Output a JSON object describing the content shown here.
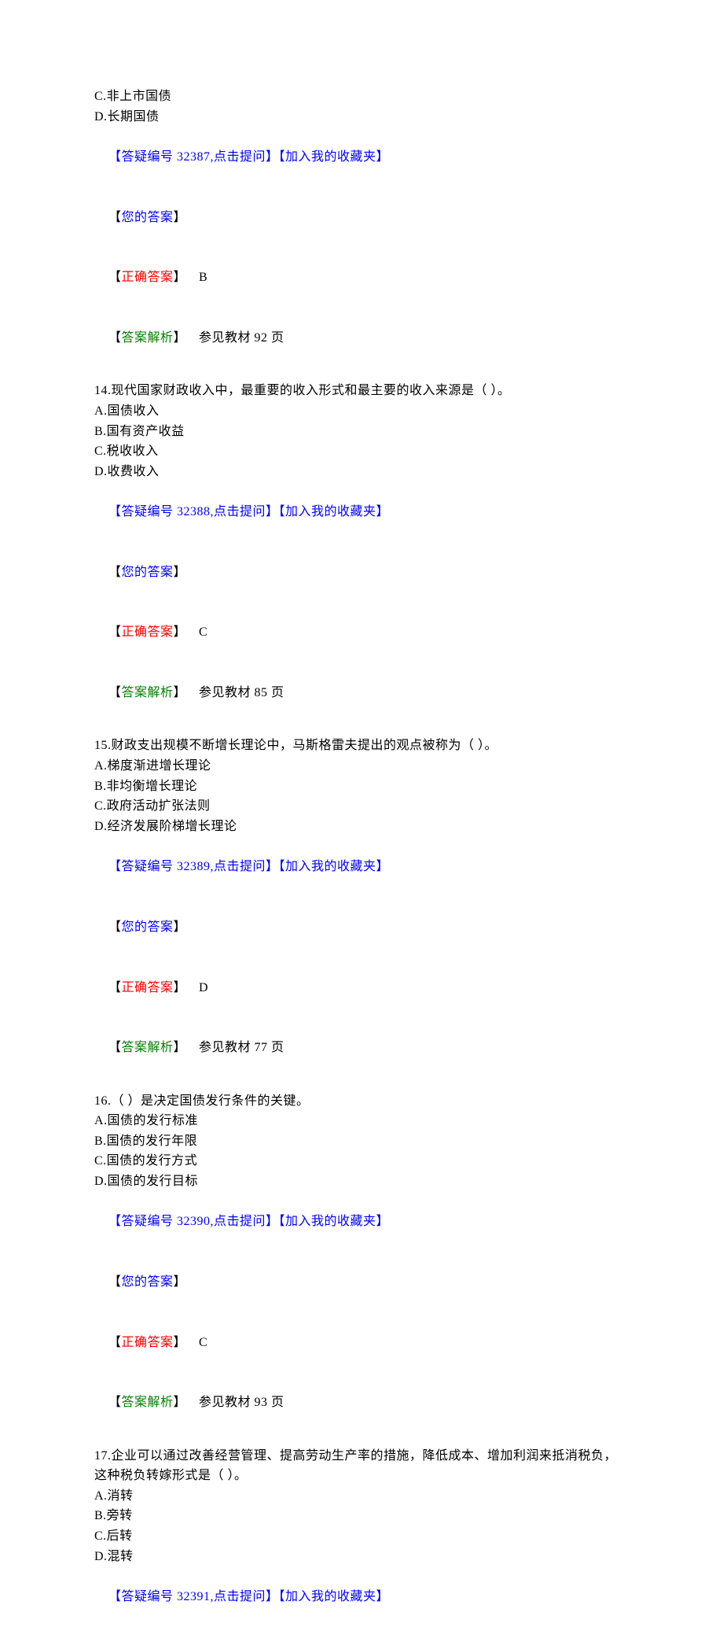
{
  "q13": {
    "optC": "C.非上市国债",
    "optD": "D.长期国债",
    "askPrefix": "【答疑编号 32387,点击提问】",
    "fav": "【加入我的收藏夹】",
    "yourLabelOpen": "【",
    "yourLabelText": "您的答案",
    "yourLabelClose": "】",
    "correctLabelOpen": "【",
    "correctLabelText": "正确答案",
    "correctLabelClose": "】",
    "correctValue": "B",
    "explainLabelOpen": "【",
    "explainLabelText": "答案解析",
    "explainLabelClose": "】",
    "explainText": "参见教材 92 页"
  },
  "q14": {
    "stem": "14.现代国家财政收入中，最重要的收入形式和最主要的收入来源是（ ）。",
    "optA": "A.国债收入",
    "optB": "B.国有资产收益",
    "optC": "C.税收收入",
    "optD": "D.收费收入",
    "askPrefix": "【答疑编号 32388,点击提问】",
    "fav": "【加入我的收藏夹】",
    "yourLabelOpen": "【",
    "yourLabelText": "您的答案",
    "yourLabelClose": "】",
    "correctLabelOpen": "【",
    "correctLabelText": "正确答案",
    "correctLabelClose": "】",
    "correctValue": "C",
    "explainLabelOpen": "【",
    "explainLabelText": "答案解析",
    "explainLabelClose": "】",
    "explainText": "参见教材 85 页"
  },
  "q15": {
    "stem": "15.财政支出规模不断增长理论中，马斯格雷夫提出的观点被称为（ ）。",
    "optA": "A.梯度渐进增长理论",
    "optB": "B.非均衡增长理论",
    "optC": "C.政府活动扩张法则",
    "optD": "D.经济发展阶梯增长理论",
    "askPrefix": "【答疑编号 32389,点击提问】",
    "fav": "【加入我的收藏夹】",
    "yourLabelOpen": "【",
    "yourLabelText": "您的答案",
    "yourLabelClose": "】",
    "correctLabelOpen": "【",
    "correctLabelText": "正确答案",
    "correctLabelClose": "】",
    "correctValue": "D",
    "explainLabelOpen": "【",
    "explainLabelText": "答案解析",
    "explainLabelClose": "】",
    "explainText": "参见教材 77 页"
  },
  "q16": {
    "stem": "16.（ ）是决定国债发行条件的关键。",
    "optA": "A.国债的发行标准",
    "optB": "B.国债的发行年限",
    "optC": "C.国债的发行方式",
    "optD": "D.国债的发行目标",
    "askPrefix": "【答疑编号 32390,点击提问】",
    "fav": "【加入我的收藏夹】",
    "yourLabelOpen": "【",
    "yourLabelText": "您的答案",
    "yourLabelClose": "】",
    "correctLabelOpen": "【",
    "correctLabelText": "正确答案",
    "correctLabelClose": "】",
    "correctValue": "C",
    "explainLabelOpen": "【",
    "explainLabelText": "答案解析",
    "explainLabelClose": "】",
    "explainText": "参见教材 93 页"
  },
  "q17": {
    "stem": "17.企业可以通过改善经营管理、提高劳动生产率的措施，降低成本、增加利润来抵消税负，这种税负转嫁形式是（ ）。",
    "optA": "A.消转",
    "optB": "B.旁转",
    "optC": "C.后转",
    "optD": "D.混转",
    "askPrefix": "【答疑编号 32391,点击提问】",
    "fav": "【加入我的收藏夹】"
  }
}
